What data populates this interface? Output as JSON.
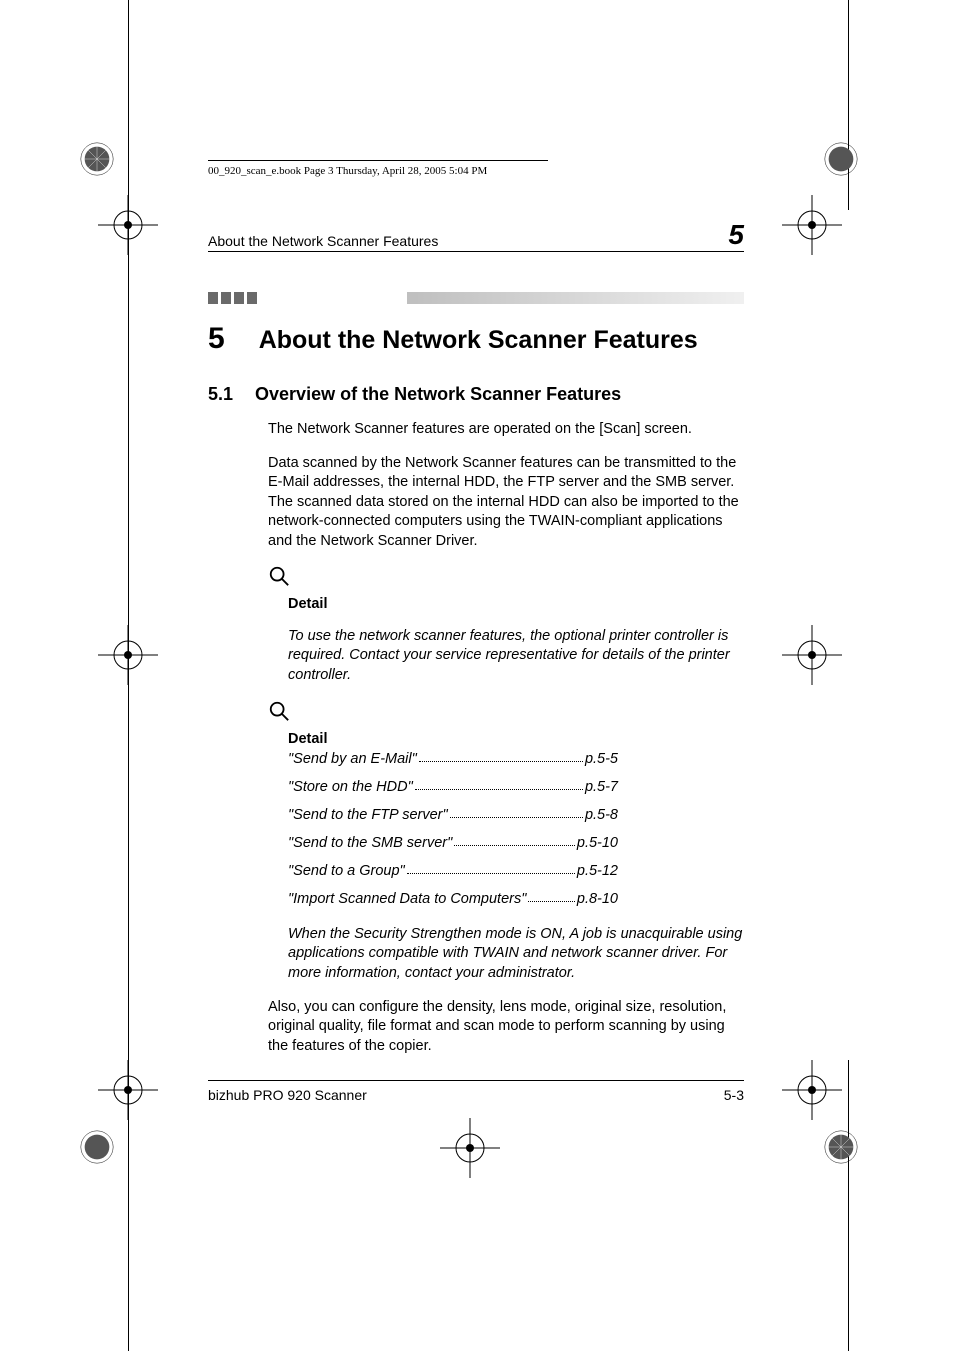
{
  "crop_header": "00_920_scan_e.book  Page 3  Thursday, April 28, 2005  5:04 PM",
  "running_head": {
    "left": "About the Network Scanner Features",
    "right": "5"
  },
  "chapter": {
    "number": "5",
    "title": "About the Network Scanner Features"
  },
  "section": {
    "number": "5.1",
    "title": "Overview of the Network Scanner Features"
  },
  "para_intro": "The Network Scanner features are operated on the [Scan] screen.",
  "para_desc": "Data scanned by the Network Scanner features can be transmitted to the E-Mail addresses, the internal HDD, the FTP server and the SMB server. The scanned data stored on the internal HDD can also be imported to the network-connected computers using the TWAIN-compliant applications and the Network Scanner Driver.",
  "detail1": {
    "label": "Detail",
    "text": "To use the network scanner features, the optional printer controller is required. Contact your service representative for details of the printer controller."
  },
  "detail2": {
    "label": "Detail",
    "toc": [
      {
        "label": "\"Send by an E-Mail\"",
        "page": "p.5-5"
      },
      {
        "label": "\"Store on the HDD\"",
        "page": "p.5-7"
      },
      {
        "label": "\"Send to the FTP server\"",
        "page": "p.5-8"
      },
      {
        "label": "\"Send to the SMB server\"",
        "page": "p.5-10"
      },
      {
        "label": "\"Send to a Group\"",
        "page": "p.5-12"
      },
      {
        "label": "\"Import Scanned Data to Computers\"",
        "page": "p.8-10"
      }
    ],
    "note": "When the Security Strengthen mode is ON, A job is unacquirable using applications compatible with TWAIN and network scanner driver. For more information, contact your administrator."
  },
  "para_also": "Also, you can configure the density, lens mode, original size, resolution, original quality, file format and scan mode to perform scanning by using the features of the copier.",
  "footer": {
    "left": "bizhub PRO 920 Scanner",
    "right": "5-3"
  }
}
